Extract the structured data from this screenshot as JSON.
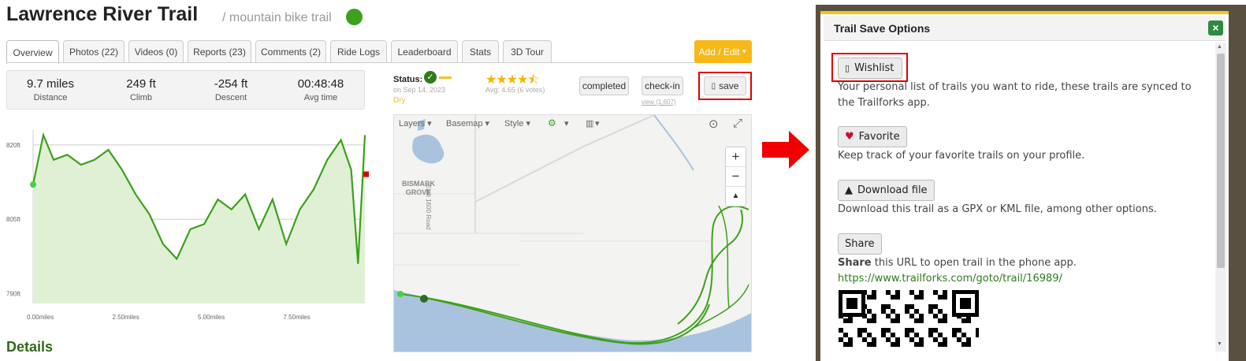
{
  "trail": {
    "name": "Lawrence River Trail",
    "type": "/ mountain bike trail"
  },
  "tabs": [
    "Overview",
    "Photos (22)",
    "Videos (0)",
    "Reports (23)",
    "Comments (2)",
    "Ride Logs",
    "Leaderboard",
    "Stats",
    "3D Tour"
  ],
  "add_edit": "Add / Edit",
  "stats": [
    {
      "value": "9.7 miles",
      "label": "Distance"
    },
    {
      "value": "249 ft",
      "label": "Climb"
    },
    {
      "value": "-254 ft",
      "label": "Descent"
    },
    {
      "value": "00:48:48",
      "label": "Avg time"
    }
  ],
  "status": {
    "label": "Status:",
    "date": "on Sep 14, 2023",
    "condition": "Dry"
  },
  "rating": {
    "stars": "★★★★⯪",
    "avg": "Avg: 4.65 (6 votes)"
  },
  "actions": {
    "completed": "completed",
    "checkin": "check-in",
    "view": "view (1,607)",
    "save": "save"
  },
  "map": {
    "tools": [
      "Layers ▾",
      "Basemap ▾",
      "Style ▾",
      "▾",
      "▾"
    ],
    "labels": {
      "place": "BISMARK\nGROVE",
      "road": "East 1600 Road"
    },
    "zoom_in": "+",
    "zoom_out": "−",
    "north": "▲"
  },
  "chart": {
    "y_ticks": [
      "820ft",
      "805ft",
      "790ft"
    ],
    "x_ticks": [
      "0.00miles",
      "2.50miles",
      "5.00miles",
      "7.50miles"
    ]
  },
  "chart_data": {
    "type": "area",
    "xlabel": "",
    "ylabel": "",
    "x": [
      0,
      0.3,
      0.6,
      1.0,
      1.4,
      1.8,
      2.2,
      2.6,
      3.0,
      3.4,
      3.8,
      4.2,
      4.6,
      5.0,
      5.4,
      5.8,
      6.2,
      6.6,
      7.0,
      7.4,
      7.8,
      8.2,
      8.6,
      9.0,
      9.3,
      9.5,
      9.7
    ],
    "y": [
      812,
      822,
      817,
      818,
      816,
      817,
      819,
      815,
      810,
      806,
      800,
      797,
      803,
      804,
      809,
      807,
      810,
      803,
      809,
      800,
      807,
      811,
      817,
      821,
      815,
      796,
      822
    ],
    "xlim": [
      0,
      9.7
    ],
    "ylim": [
      788,
      823
    ]
  },
  "details": "Details",
  "panel": {
    "title": "Trail Save Options",
    "close": "×",
    "wishlist": {
      "label": "Wishlist",
      "desc": "Your personal list of trails you want to ride, these trails are synced to the Trailforks app."
    },
    "favorite": {
      "label": "Favorite",
      "desc": "Keep track of your favorite trails on your profile."
    },
    "download": {
      "label": "Download file",
      "desc": "Download this trail as a GPX or KML file, among other options."
    },
    "share": {
      "label": "Share",
      "bold": "Share",
      "desc": " this URL to open trail in the phone app.",
      "url": "https://www.trailforks.com/goto/trail/16989/"
    }
  },
  "colors": {
    "accent": "#f8b818",
    "trail_green": "#3ea01b",
    "highlight": "#e10000"
  }
}
